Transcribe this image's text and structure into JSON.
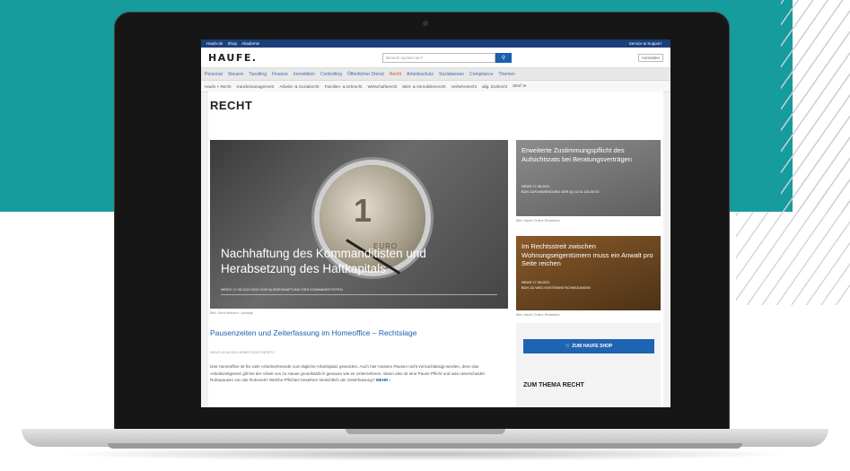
{
  "colors": {
    "teal_background": "#169c9c",
    "haufe_blue": "#1b3f7a",
    "link_blue": "#1b5fae",
    "active_orange": "#c9591a"
  },
  "topbar": {
    "links": [
      "Haufe.de",
      "Shop",
      "Akademie"
    ],
    "service": "Service & Support"
  },
  "header": {
    "logo": "HAUFE.",
    "search_placeholder": "Bereich suchen Sie?",
    "search_icon": "magnifier-icon",
    "login": "Anmelden"
  },
  "nav": {
    "items": [
      "Personal",
      "Steuern",
      "Taxulting",
      "Finance",
      "Immobilien",
      "Controlling",
      "Öffentlicher Dienst",
      "Recht",
      "Arbeitsschutz",
      "Sozialwesen",
      "Compliance",
      "Themen"
    ],
    "active": "Recht"
  },
  "subnav": {
    "items": [
      "Haufe > Recht",
      "Kanzleimanagement",
      "Arbeits- & Sozialrecht",
      "Familien- & Erbrecht",
      "Wirtschaftsrecht",
      "Miet- & Immobilienrecht",
      "Verkehrsrecht",
      "allg. Zivilrecht",
      "Straf ≫"
    ]
  },
  "page": {
    "title": "RECHT"
  },
  "hero": {
    "coin_number": "1",
    "coin_word": "EURO",
    "title": "Nachhaftung des Kommanditisten und Herabsetzung des Haftkapitals",
    "meta": "NEWS  17.08.2021  BGH ZUR AUSSENHAFTUNG DES KOMMANDITISTEN",
    "caption": "Bild: Gerd Altmann / pixabay"
  },
  "side1": {
    "title": "Erweiterte Zustimmungspflicht des Aufsichtsrats bei Beratungsverträgen",
    "meta1": "NEWS  17.08.2021",
    "meta2": "BGH ZUR ANWENDUNG DER §§ 114 & 115 AKTG",
    "caption": "Bild: Haufe Online Redaktion"
  },
  "side2": {
    "title": "Im Rechtsstreit zwischen Wohnungseigentümern muss ein Anwalt pro Seite reichen",
    "meta1": "NEWS  17.08.2021",
    "meta2": "BGH ZU WEG KOSTENENTSCHEIDUNGEN",
    "caption": "Bild: Haufe Online Redaktion"
  },
  "article": {
    "title": "Pausenzeiten und Zeiterfassung im Homeoffice – Rechtslage",
    "meta": "NEWS  16.08.2021  ARBEITSZEITGESETZ",
    "text": "Das Homeoffice ist für viele Arbeitnehmende zum tägliche Arbeitsplatz geworden. Auch hier müssen Pausen nicht vernachlässigt werden, denn das Arbeitszeitgesetz gilt bei der Arbeit von zu Hause grundsätzlich genauso wie im Unternehmen. Wann also ist eine Pause Pflicht und was unterscheidet Ruhepausen von der Ruhezeit? Welche Pflichten bestehen hinsichtlich der Zeiterfassung?",
    "more": "MEHR ›"
  },
  "shop": {
    "button": "🛒  ZUM HAUFE SHOP",
    "heading": "ZUM THEMA RECHT"
  }
}
